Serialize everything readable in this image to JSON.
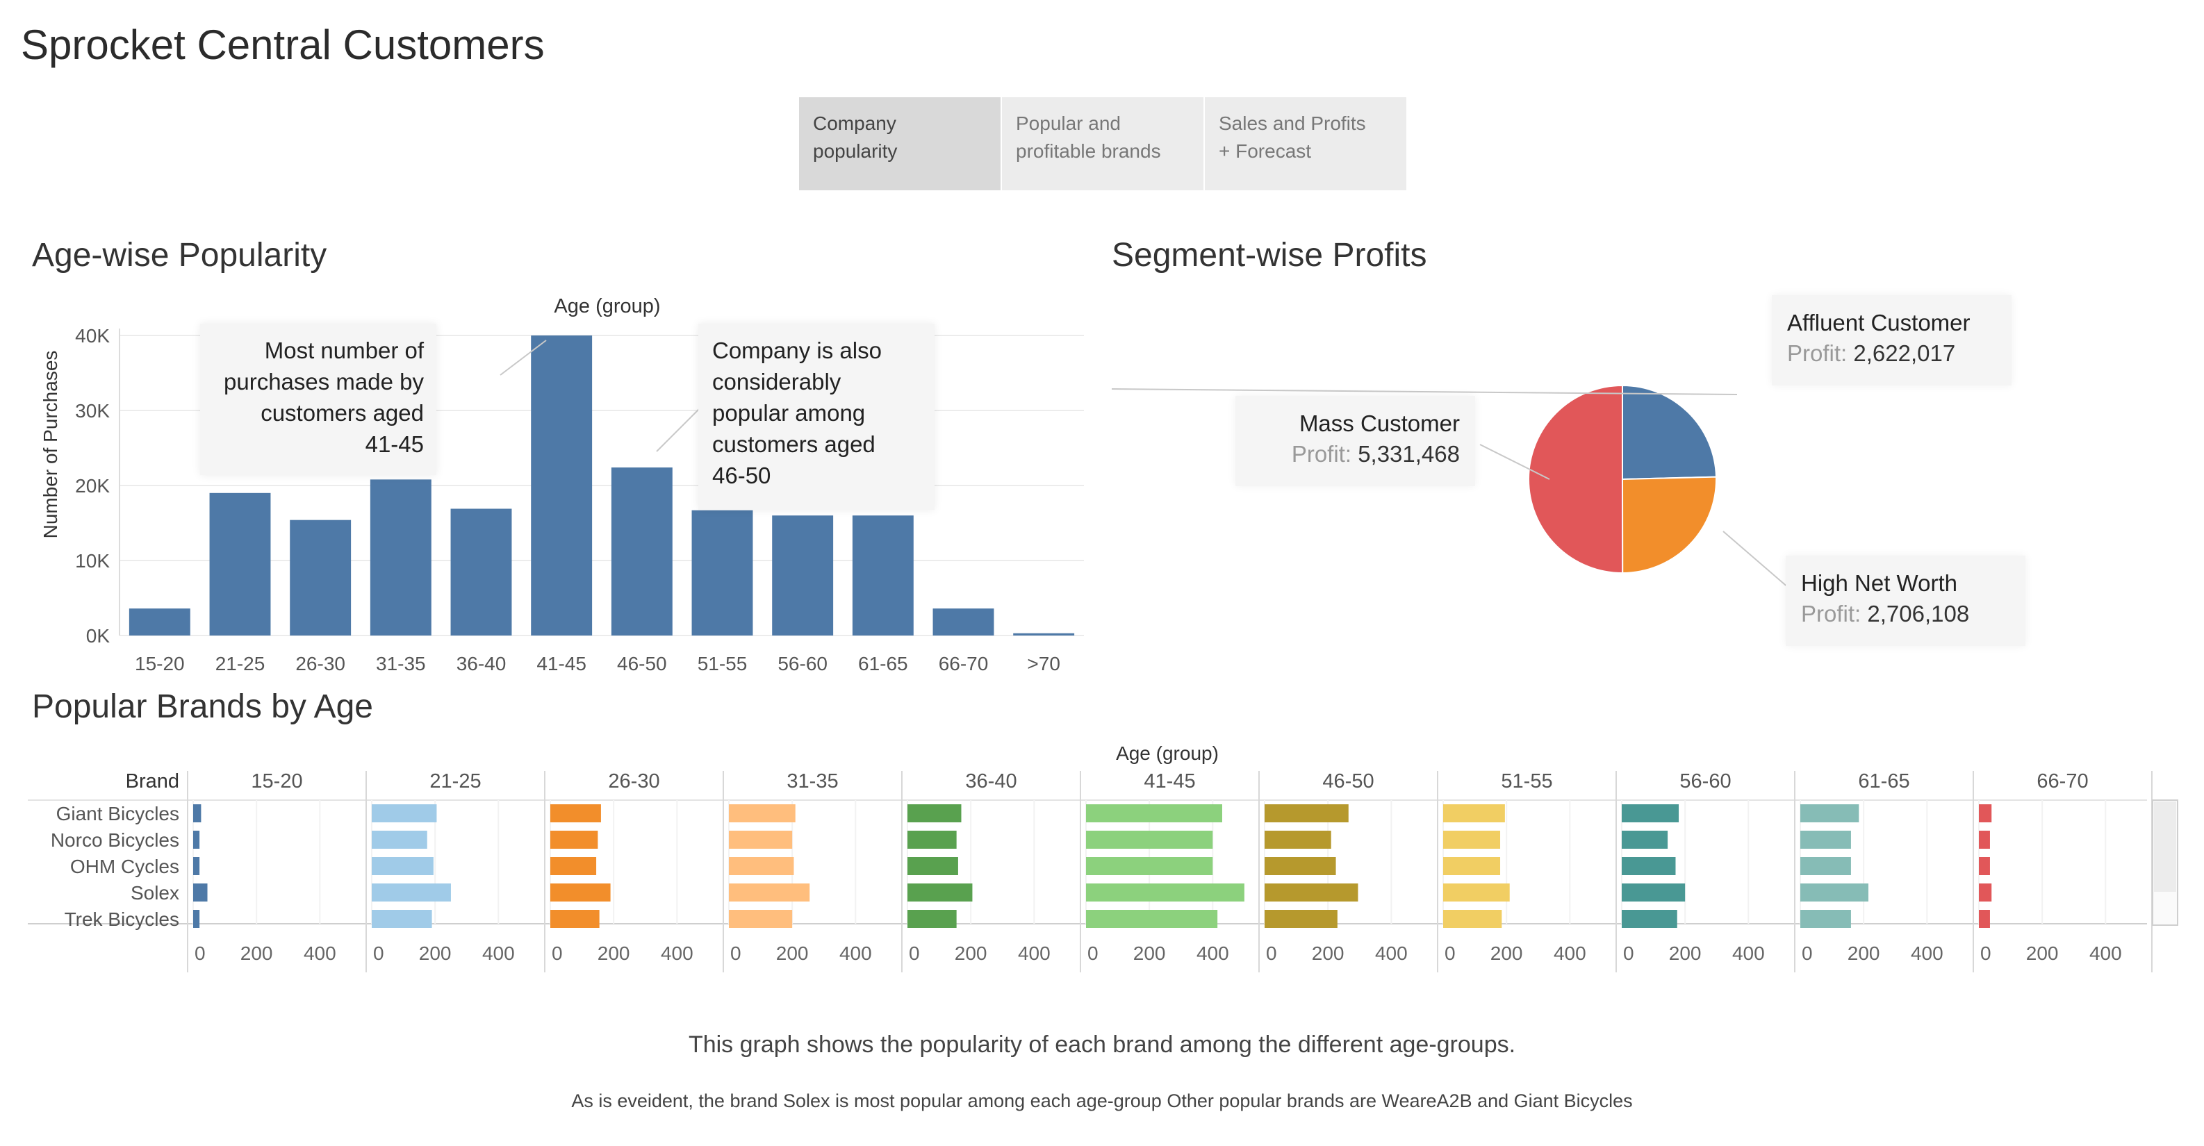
{
  "title": "Sprocket Central Customers",
  "tabs": [
    {
      "line1": "Company",
      "line2": "popularity",
      "active": true
    },
    {
      "line1": "Popular and",
      "line2": "profitable brands",
      "active": false
    },
    {
      "line1": "Sales and Profits",
      "line2": "+ Forecast",
      "active": false
    }
  ],
  "age_chart": {
    "section_title": "Age-wise Popularity",
    "annotation1": [
      "Most number of",
      "purchases made by",
      "customers aged",
      "41-45"
    ],
    "annotation2": [
      "Company is also",
      "considerably",
      "popular among",
      "customers aged",
      "46-50"
    ]
  },
  "segment_chart": {
    "section_title": "Segment-wise Profits",
    "profit_label": "Profit:"
  },
  "brands_chart": {
    "section_title": "Popular Brands by Age",
    "brand_header": "Brand",
    "age_header": "Age (group)",
    "axis_ticks": [
      "0",
      "200",
      "400"
    ]
  },
  "footer": {
    "line1": "This graph shows the popularity of each brand among the different age-groups.",
    "line2": "As is eveident, the brand Solex is most popular among each age-group  Other popular brands are WeareA2B and Giant Bicycles"
  },
  "chart_data": [
    {
      "type": "bar",
      "title": "Age-wise Popularity",
      "xlabel": "Age (group)",
      "ylabel": "Number of Purchases",
      "categories": [
        "15-20",
        "21-25",
        "26-30",
        "31-35",
        "36-40",
        "41-45",
        "46-50",
        "51-55",
        "56-60",
        "61-65",
        "66-70",
        ">70"
      ],
      "values": [
        3600,
        19000,
        15400,
        20800,
        16900,
        40000,
        22400,
        16700,
        16000,
        16000,
        3600,
        300
      ],
      "ylim": [
        0,
        40000
      ],
      "yticks": [
        "0K",
        "10K",
        "20K",
        "30K",
        "40K"
      ],
      "color": "#4e79a7",
      "grid": true
    },
    {
      "type": "pie",
      "title": "Segment-wise Profits",
      "slices": [
        {
          "name": "Affluent Customer",
          "value": 2622017,
          "display": "2,622,017",
          "color": "#4e79a7"
        },
        {
          "name": "High Net Worth",
          "value": 2706108,
          "display": "2,706,108",
          "color": "#f28e2b"
        },
        {
          "name": "Mass Customer",
          "value": 5331468,
          "display": "5,331,468",
          "color": "#e15759"
        }
      ]
    },
    {
      "type": "bar",
      "title": "Popular Brands by Age",
      "orientation": "horizontal",
      "brands": [
        "Giant Bicycles",
        "Norco Bicycles",
        "OHM Cycles",
        "Solex",
        "Trek Bicycles"
      ],
      "age_groups": [
        "15-20",
        "21-25",
        "26-30",
        "31-35",
        "36-40",
        "41-45",
        "46-50",
        "51-55",
        "56-60",
        "61-65",
        "66-70"
      ],
      "colors": [
        "#4e79a7",
        "#a0cbe8",
        "#f28e2b",
        "#ffbe7d",
        "#59a14f",
        "#8cd17d",
        "#b6992d",
        "#f1ce63",
        "#499894",
        "#86bcb6",
        "#e15759"
      ],
      "values": [
        [
          25,
          205,
          160,
          210,
          170,
          430,
          265,
          195,
          180,
          185,
          40
        ],
        [
          20,
          175,
          150,
          200,
          155,
          400,
          210,
          180,
          145,
          160,
          35
        ],
        [
          20,
          195,
          145,
          205,
          160,
          400,
          225,
          180,
          170,
          160,
          35
        ],
        [
          45,
          250,
          190,
          255,
          205,
          500,
          295,
          210,
          200,
          215,
          40
        ],
        [
          20,
          190,
          155,
          200,
          155,
          415,
          230,
          185,
          175,
          160,
          35
        ]
      ],
      "xlim": [
        0,
        520
      ],
      "xticks": [
        0,
        200,
        400
      ]
    }
  ]
}
